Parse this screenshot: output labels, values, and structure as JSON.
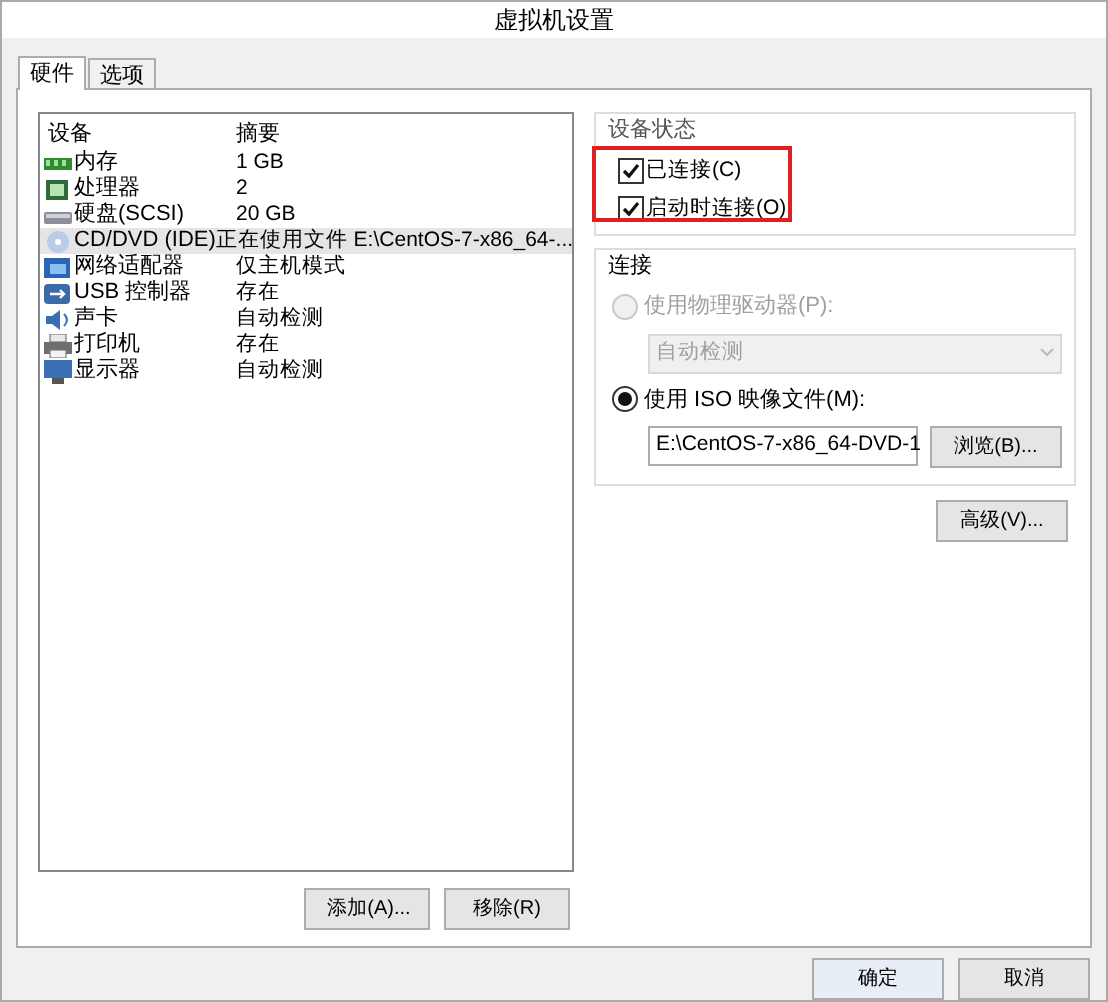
{
  "window": {
    "title": "虚拟机设置"
  },
  "tabs": [
    {
      "label": "硬件",
      "selected": true
    },
    {
      "label": "选项",
      "selected": false
    }
  ],
  "devices": {
    "columns": [
      "设备",
      "摘要"
    ],
    "rows": [
      {
        "device": "内存",
        "summary": "1 GB",
        "selected": false
      },
      {
        "device": "处理器",
        "summary": "2",
        "selected": false
      },
      {
        "device": "硬盘(SCSI)",
        "summary": "20 GB",
        "selected": false
      },
      {
        "device": "CD/DVD (IDE)",
        "summary": "正在使用文件 E:\\CentOS-7-x86_64-...",
        "selected": true
      },
      {
        "device": "网络适配器",
        "summary": "仅主机模式",
        "selected": false
      },
      {
        "device": "USB 控制器",
        "summary": "存在",
        "selected": false
      },
      {
        "device": "声卡",
        "summary": "自动检测",
        "selected": false
      },
      {
        "device": "打印机",
        "summary": "存在",
        "selected": false
      },
      {
        "device": "显示器",
        "summary": "自动检测",
        "selected": false
      }
    ],
    "buttons": [
      "添加(A)...",
      "移除(R)"
    ]
  },
  "device_status": {
    "title": "设备状态",
    "options": [
      {
        "label": "已连接(C)",
        "checked": true
      },
      {
        "label": "启动时连接(O)",
        "checked": true
      }
    ]
  },
  "connection": {
    "title": "连接",
    "options": [
      {
        "label": "使用物理驱动器(P):",
        "selected": false,
        "disabled": true,
        "value": "自动检测"
      },
      {
        "label": "使用 ISO 映像文件(M):",
        "selected": true,
        "disabled": false,
        "value": "E:\\CentOS-7-x86_64-DVD-1",
        "button": "浏览(B)..."
      }
    ]
  },
  "advanced_button": "高级(V)...",
  "footer_buttons": [
    {
      "label": "确定",
      "default": true
    },
    {
      "label": "取消",
      "default": false
    }
  ]
}
